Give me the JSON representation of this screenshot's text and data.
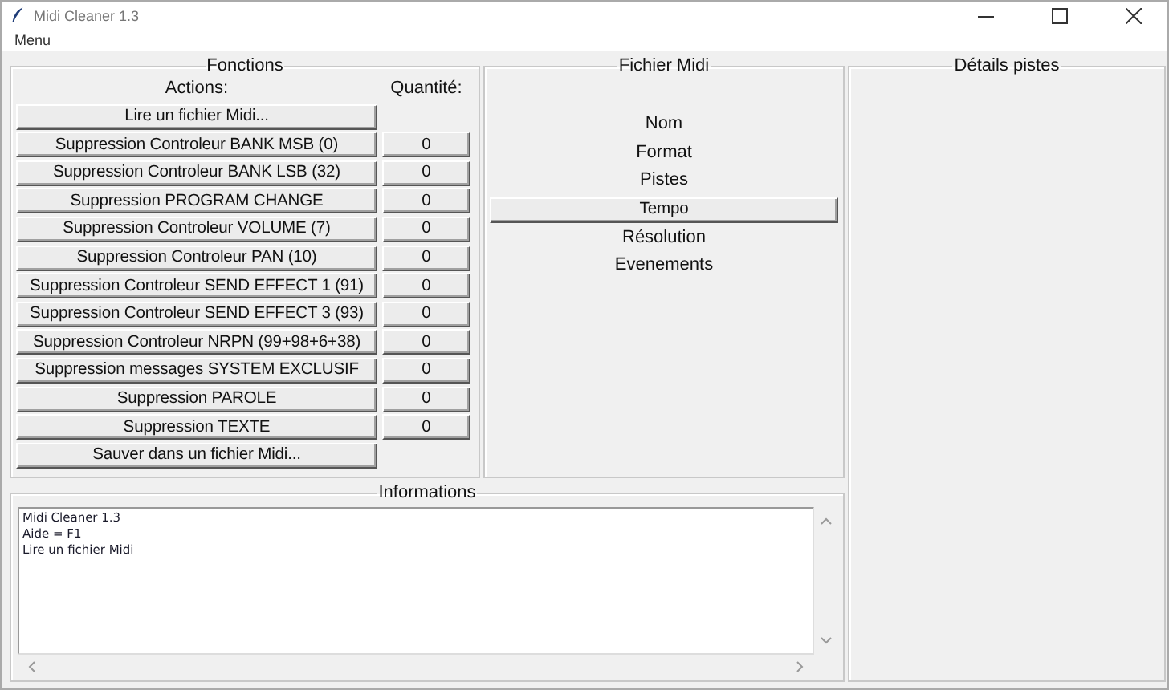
{
  "window": {
    "title": "Midi Cleaner 1.3"
  },
  "menu": [
    "Menu"
  ],
  "fonctions": {
    "title": "Fonctions",
    "actions_header": "Actions:",
    "quantity_header": "Quantité:",
    "rows": [
      {
        "action": "Lire un fichier Midi..."
      },
      {
        "action": "Suppression Controleur BANK MSB (0)",
        "quantity": "0"
      },
      {
        "action": "Suppression Controleur BANK LSB (32)",
        "quantity": "0"
      },
      {
        "action": "Suppression PROGRAM CHANGE",
        "quantity": "0"
      },
      {
        "action": "Suppression Controleur VOLUME (7)",
        "quantity": "0"
      },
      {
        "action": "Suppression Controleur PAN (10)",
        "quantity": "0"
      },
      {
        "action": "Suppression Controleur SEND EFFECT 1 (91)",
        "quantity": "0"
      },
      {
        "action": "Suppression Controleur SEND EFFECT 3 (93)",
        "quantity": "0"
      },
      {
        "action": "Suppression Controleur NRPN (99+98+6+38)",
        "quantity": "0"
      },
      {
        "action": "Suppression messages SYSTEM EXCLUSIF",
        "quantity": "0"
      },
      {
        "action": "Suppression PAROLE",
        "quantity": "0"
      },
      {
        "action": "Suppression TEXTE",
        "quantity": "0"
      },
      {
        "action": "Sauver dans un fichier Midi..."
      }
    ]
  },
  "fichier": {
    "title": "Fichier Midi",
    "items": [
      {
        "kind": "label",
        "text": "Nom"
      },
      {
        "kind": "label",
        "text": "Format"
      },
      {
        "kind": "label",
        "text": "Pistes"
      },
      {
        "kind": "button",
        "text": "Tempo"
      },
      {
        "kind": "label",
        "text": "Résolution"
      },
      {
        "kind": "label",
        "text": "Evenements"
      }
    ]
  },
  "details": {
    "title": "Détails pistes"
  },
  "informations": {
    "title": "Informations",
    "lines": [
      "Midi Cleaner 1.3",
      "Aide = F1",
      "Lire un fichier Midi"
    ]
  }
}
